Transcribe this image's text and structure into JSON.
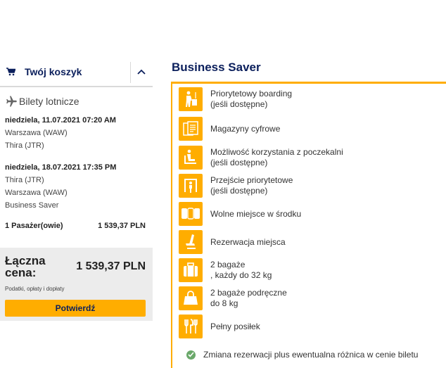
{
  "cart": {
    "title": "Twój koszyk",
    "tickets_heading": "Bilety lotnicze",
    "outbound": {
      "date": "niedziela, 11.07.2021 07:20 AM",
      "from": "Warszawa (WAW)",
      "to": "Thira (JTR)"
    },
    "inbound": {
      "date": "niedziela, 18.07.2021 17:35 PM",
      "from": "Thira (JTR)",
      "to": "Warszawa (WAW)",
      "fare": "Business Saver"
    },
    "passengers_label": "1 Pasażer(owie)",
    "passengers_price": "1 539,37 PLN",
    "total_label": "Łączna cena:",
    "total_value": "1 539,37 PLN",
    "taxes_note": "Podatki, opłaty i dopłaty",
    "confirm_label": "Potwierdź"
  },
  "fare": {
    "title": "Business Saver",
    "features": [
      {
        "icon": "priority-boarding-icon",
        "line1": "Priorytetowy boarding",
        "line2": "(jeśli dostępne)"
      },
      {
        "icon": "digital-magazines-icon",
        "line1": "Magazyny cyfrowe",
        "line2": ""
      },
      {
        "icon": "lounge-icon",
        "line1": "Możliwość korzystania z poczekalni",
        "line2": "(jeśli dostępne)"
      },
      {
        "icon": "priority-lane-icon",
        "line1": "Przejście priorytetowe",
        "line2": "(jeśli dostępne)"
      },
      {
        "icon": "free-middle-seat-icon",
        "line1": "Wolne miejsce w środku",
        "line2": ""
      },
      {
        "icon": "seat-reservation-icon",
        "line1": "Rezerwacja miejsca",
        "line2": ""
      },
      {
        "icon": "checked-baggage-icon",
        "line1": "2 bagaże",
        "line2": ", każdy do 32 kg"
      },
      {
        "icon": "cabin-baggage-icon",
        "line1": "2 bagaże podręczne",
        "line2": "do 8 kg"
      },
      {
        "icon": "meal-icon",
        "line1": "Pełny posiłek",
        "line2": ""
      }
    ],
    "rebooking": "Zmiana rezerwacji plus ewentualna różnica w cenie biletu"
  },
  "colors": {
    "accent": "#ffad00",
    "navy": "#0b1f5c",
    "panel_bg": "#ececec",
    "check": "#6aa86a"
  }
}
